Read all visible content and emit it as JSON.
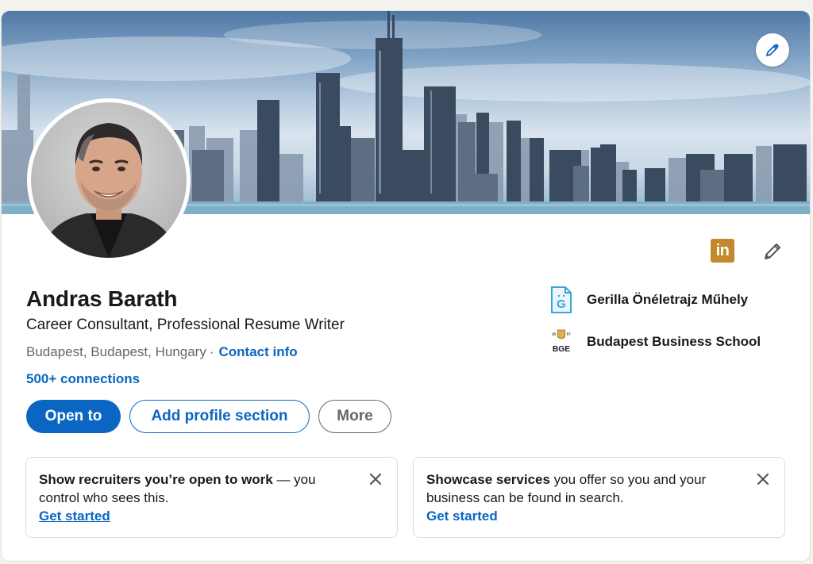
{
  "profile": {
    "name": "Andras Barath",
    "headline": "Career Consultant, Professional Resume Writer",
    "location": "Budapest, Budapest, Hungary",
    "separator": "·",
    "contact_info_label": "Contact info",
    "connections": "500+ connections",
    "linkedin_badge_text": "in"
  },
  "actions": {
    "open_to_label": "Open to",
    "add_section_label": "Add profile section",
    "more_label": "More"
  },
  "organizations": [
    {
      "name": "Gerilla Önéletrajz Műhely",
      "logo_text": "G",
      "logo_icon": "document-logo-icon"
    },
    {
      "name": "Budapest Business School",
      "logo_text": "BGE",
      "logo_years": [
        "18",
        "57"
      ],
      "logo_icon": "bge-logo-icon"
    }
  ],
  "promos": [
    {
      "bold_text": "Show recruiters you’re open to work",
      "rest_text": " — you control who sees this.",
      "cta": "Get started"
    },
    {
      "bold_text": "Showcase services",
      "rest_text": " you offer so you and your business can be found in search.",
      "cta": "Get started"
    }
  ],
  "icons": {
    "banner_edit": "pencil-icon",
    "profile_edit": "pencil-icon",
    "close": "close-icon"
  },
  "colors": {
    "link_blue": "#0a66c2",
    "linkedin_badge": "#c28a2c",
    "text_primary": "#191919",
    "text_secondary": "#666666"
  }
}
